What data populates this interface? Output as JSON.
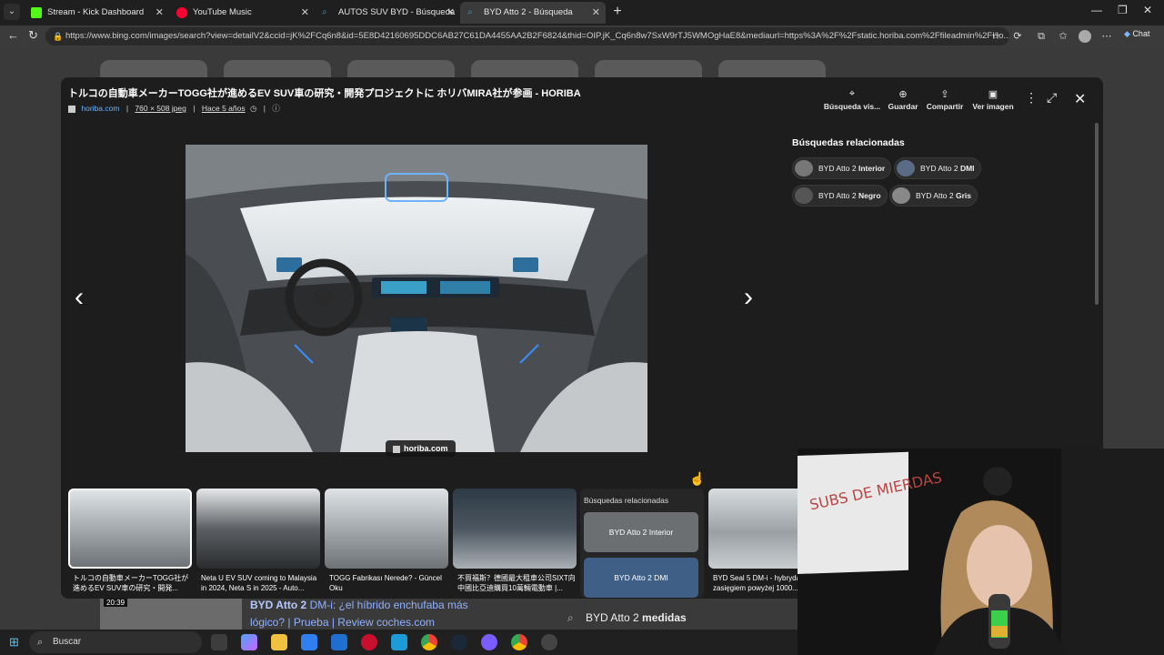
{
  "browser": {
    "tabs": [
      {
        "label": "Stream - Kick Dashboard",
        "icon": "kick-icon",
        "color": "#53fc18"
      },
      {
        "label": "YouTube Music",
        "icon": "youtube-music-icon",
        "color": "#ff0033"
      },
      {
        "label": "AUTOS SUV BYD - Búsqueda",
        "icon": "search-icon",
        "color": "#4a90e2"
      },
      {
        "label": "BYD Atto 2 - Búsqueda",
        "icon": "search-icon",
        "color": "#4a90e2"
      }
    ],
    "url": "https://www.bing.com/images/search?view=detailV2&ccid=jK%2FCq6n8&id=5E8D42160695DDC6AB27C61DA4455AA2B2F6824&thid=OIP.jK_Cq6n8w7SxW9rTJ5WMOgHaE8&mediaurl=https%3A%2F%2Fstatic.horiba.com%2Ffileadmin%2FHo...",
    "chat_label": "Chat"
  },
  "modal": {
    "title": "トルコの自動車メーカーTOGG社が進めるEV SUV車の研究・開発プロジェクトに ホリバMIRA社が参画 - HORIBA",
    "source": "horiba.com",
    "dimensions": "760 × 508 jpeg",
    "age": "Hace 5 años",
    "separator": "|",
    "actions": [
      {
        "label": "Búsqueda vis...",
        "icon": "visual-search-icon"
      },
      {
        "label": "Guardar",
        "icon": "save-icon"
      },
      {
        "label": "Compartir",
        "icon": "share-icon"
      },
      {
        "label": "Ver imagen",
        "icon": "view-image-icon"
      }
    ],
    "image_credit": "horiba.com",
    "related_title": "Búsquedas relacionadas",
    "related_chips": [
      {
        "prefix": "BYD Atto 2 ",
        "bold": "Interior"
      },
      {
        "prefix": "BYD Atto 2 ",
        "bold": "DMI"
      },
      {
        "prefix": "BYD Atto 2 ",
        "bold": "Negro"
      },
      {
        "prefix": "BYD Atto 2 ",
        "bold": "Gris"
      }
    ],
    "thumbnails": [
      {
        "caption": "トルコの自動車メーカーTOGG社が進めるEV SUV車の研究・開発..."
      },
      {
        "caption": "Neta U EV SUV coming to Malaysia in 2024, Neta S in 2025 - Auto..."
      },
      {
        "caption": "TOGG Fabrikası Nerede? - Güncel Oku"
      },
      {
        "caption": "不買福斯？德國最大租車公司SIXT向中國比亞迪購買10萬輛電動車 |..."
      },
      {
        "caption": "BYD Seal 5 DM-i - hybryda z zasięgiem powyżej 1000..."
      }
    ],
    "strip_related": {
      "title": "Búsquedas relacionadas",
      "cards": [
        "BYD Atto 2 Interior",
        "BYD Atto 2 DMI"
      ]
    }
  },
  "background_page": {
    "video_time": "20:39",
    "result_title_bold": "BYD Atto 2",
    "result_title_rest": " DM-i: ¿el híbrido enchufaba más lógico? | Prueba | Review coches.com",
    "suggestion_prefix": "BYD Atto 2 ",
    "suggestion_bold": "medidas"
  },
  "taskbar": {
    "search_placeholder": "Buscar"
  },
  "webcam": {
    "whiteboard_text": "SUBS DE MIERDAS"
  }
}
